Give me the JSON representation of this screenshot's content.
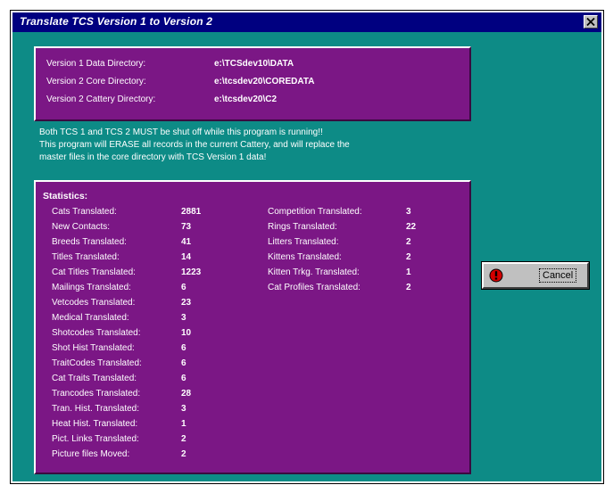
{
  "window": {
    "title": "Translate TCS Version 1 to Version 2"
  },
  "directories": [
    {
      "label": "Version 1 Data Directory:",
      "value": "e:\\TCSdev10\\DATA"
    },
    {
      "label": "Version 2 Core Directory:",
      "value": "e:\\tcsdev20\\COREDATA"
    },
    {
      "label": "Version 2 Cattery Directory:",
      "value": "e:\\tcsdev20\\C2"
    }
  ],
  "warning": {
    "line1": "Both TCS 1 and TCS 2 MUST be shut off while this program is running!!",
    "line2": "This program will ERASE all records in the current Cattery, and will replace the",
    "line3": "master files in the core directory with TCS Version 1 data!"
  },
  "statistics": {
    "heading": "Statistics:",
    "left": [
      {
        "label": "Cats Translated:",
        "value": "2881"
      },
      {
        "label": "New Contacts:",
        "value": "73"
      },
      {
        "label": "Breeds Translated:",
        "value": "41"
      },
      {
        "label": "Titles Translated:",
        "value": "14"
      },
      {
        "label": "Cat Titles Translated:",
        "value": "1223"
      },
      {
        "label": "Mailings Translated:",
        "value": "6"
      },
      {
        "label": "Vetcodes Translated:",
        "value": "23"
      },
      {
        "label": "Medical Translated:",
        "value": "3"
      },
      {
        "label": "Shotcodes Translated:",
        "value": "10"
      },
      {
        "label": "Shot Hist Translated:",
        "value": "6"
      },
      {
        "label": "TraitCodes Translated:",
        "value": "6"
      },
      {
        "label": "Cat Traits Translated:",
        "value": "6"
      },
      {
        "label": "Trancodes Translated:",
        "value": "28"
      },
      {
        "label": "Tran. Hist. Translated:",
        "value": "3"
      },
      {
        "label": "Heat Hist. Translated:",
        "value": "1"
      },
      {
        "label": "Pict. Links Translated:",
        "value": "2"
      },
      {
        "label": "Picture files Moved:",
        "value": "2"
      }
    ],
    "right": [
      {
        "label": "Competition Translated:",
        "value": "3"
      },
      {
        "label": "Rings Translated:",
        "value": "22"
      },
      {
        "label": "Litters Translated:",
        "value": "2"
      },
      {
        "label": "Kittens Translated:",
        "value": "2"
      },
      {
        "label": "Kitten Trkg. Translated:",
        "value": "1"
      },
      {
        "label": "Cat Profiles Translated:",
        "value": "2"
      }
    ]
  },
  "buttons": {
    "cancel_label": "Cancel",
    "cancel_icon": "stop-icon",
    "close_icon": "close-icon"
  },
  "colors": {
    "title_bar": "#000080",
    "background": "#0d8b86",
    "panel": "#7b1785"
  }
}
